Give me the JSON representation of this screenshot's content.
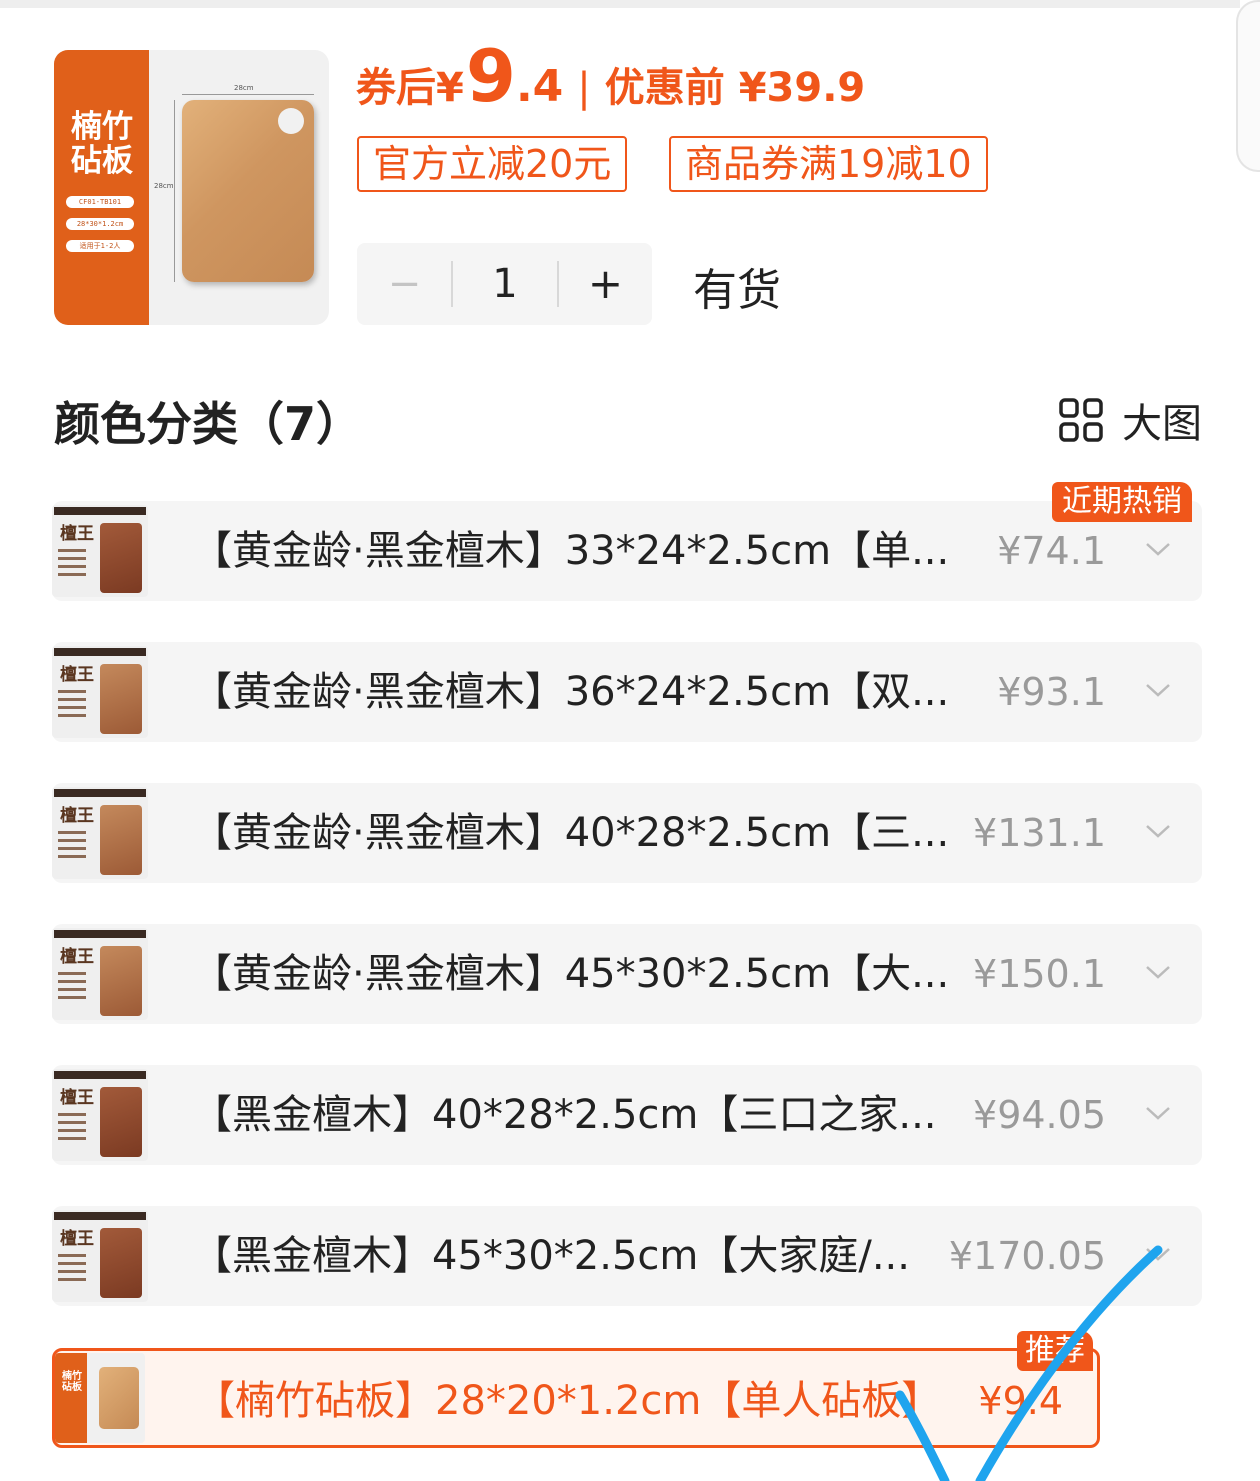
{
  "product": {
    "thumb_title": "楠竹\n砧板",
    "thumb_pills": [
      "CF01-TB101",
      "28*30*1.2cm",
      "适用于1-2人"
    ],
    "thumb_dim_top": "28cm",
    "thumb_dim_side": "28cm",
    "price_after_label": "券后",
    "price_currency": "¥",
    "price_after_int": "9",
    "price_after_dec": ".4",
    "price_sep": "|",
    "price_before": "优惠前 ¥39.9",
    "badges": [
      "官方立减20元",
      "商品券满19减10"
    ],
    "quantity": "1",
    "minus_label": "−",
    "plus_label": "+",
    "stock": "有货"
  },
  "section": {
    "title": "颜色分类（7）",
    "big_view_label": "大图"
  },
  "options": [
    {
      "label": "【黄金龄·黑金檀木】33*24*2.5cm【单...",
      "price": "¥74.1",
      "tag": "近期热销"
    },
    {
      "label": "【黄金龄·黑金檀木】36*24*2.5cm【双...",
      "price": "¥93.1"
    },
    {
      "label": "【黄金龄·黑金檀木】40*28*2.5cm【三...",
      "price": "¥131.1"
    },
    {
      "label": "【黄金龄·黑金檀木】45*30*2.5cm【大...",
      "price": "¥150.1"
    },
    {
      "label": "【黑金檀木】40*28*2.5cm【三口之家...",
      "price": "¥94.05"
    },
    {
      "label": "【黑金檀木】45*30*2.5cm【大家庭/...",
      "price": "¥170.05"
    },
    {
      "label": "【楠竹砧板】28*20*1.2cm【单人砧板】",
      "price": "¥9.4",
      "tag": "推荐",
      "selected": true,
      "thumb_title": "楠竹砧板"
    }
  ],
  "colors": {
    "accent": "#f0561a",
    "brand_band": "#e0601a",
    "check_mark": "#1fa4ee"
  }
}
